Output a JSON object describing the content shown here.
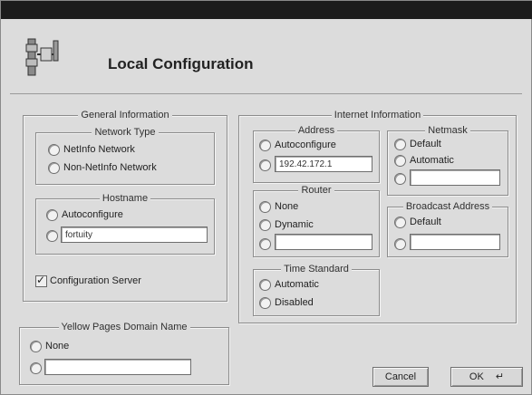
{
  "window": {
    "title": "Local Configuration",
    "app_icon": "network-config-icon"
  },
  "general": {
    "legend": "General Information",
    "network_type": {
      "legend": "Network Type",
      "options": [
        "NetInfo Network",
        "Non-NetInfo Network"
      ]
    },
    "hostname": {
      "legend": "Hostname",
      "autoconfigure_label": "Autoconfigure",
      "value": "fortuity"
    },
    "config_server_label": "Configuration Server",
    "config_server_checked": true
  },
  "yellow_pages": {
    "legend": "Yellow Pages Domain Name",
    "none_label": "None",
    "value": ""
  },
  "internet": {
    "legend": "Internet Information",
    "address": {
      "legend": "Address",
      "autoconfigure_label": "Autoconfigure",
      "value": "192.42.172.1"
    },
    "router": {
      "legend": "Router",
      "none_label": "None",
      "dynamic_label": "Dynamic",
      "value": ""
    },
    "time_standard": {
      "legend": "Time Standard",
      "automatic_label": "Automatic",
      "disabled_label": "Disabled"
    },
    "netmask": {
      "legend": "Netmask",
      "default_label": "Default",
      "automatic_label": "Automatic",
      "value": ""
    },
    "broadcast": {
      "legend": "Broadcast Address",
      "default_label": "Default",
      "value": ""
    }
  },
  "buttons": {
    "cancel": "Cancel",
    "ok": "OK"
  },
  "colors": {
    "titlebar": "#1c1c1c",
    "panel": "#dcdcdc",
    "field": "#ffffff"
  }
}
